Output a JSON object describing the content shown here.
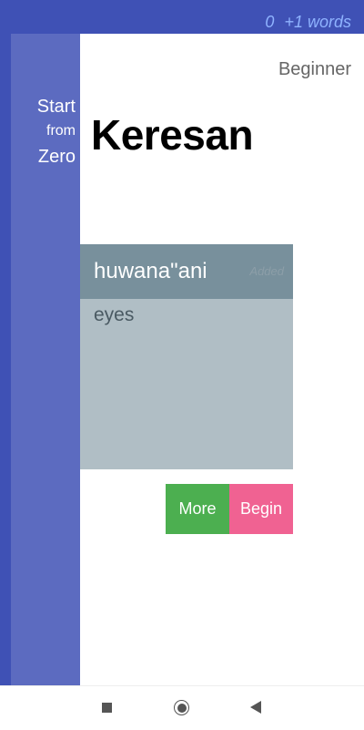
{
  "status": {
    "count": "0",
    "increment": "+1 words"
  },
  "sidebar": {
    "line1": "Start",
    "line2": "from",
    "line3": "Zero"
  },
  "header": {
    "level": "Beginner",
    "title": "Keresan"
  },
  "card": {
    "term": "huwana\"ani",
    "tag": "Added",
    "definition": "eyes"
  },
  "actions": {
    "more_label": "More",
    "begin_label": "Begin"
  },
  "colors": {
    "primary": "#3f51b5",
    "sidebar": "#5c6bc0",
    "card_header": "#78909c",
    "card_body": "#b0bec5",
    "more_button": "#4caf50",
    "begin_button": "#f06292"
  },
  "navigation": {
    "icons": [
      "recent-apps-icon",
      "home-icon",
      "back-icon"
    ]
  }
}
